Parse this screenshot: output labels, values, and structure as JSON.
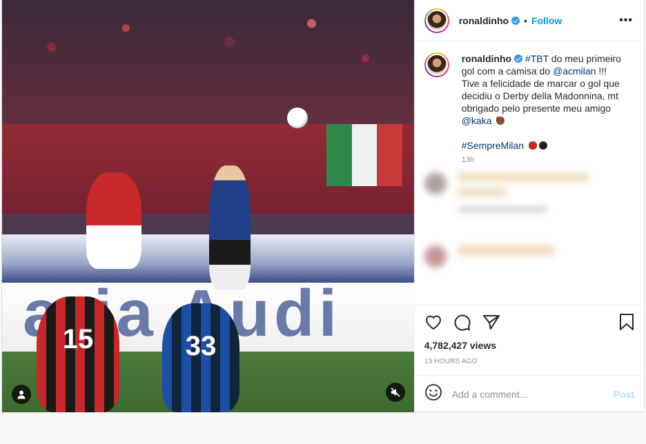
{
  "post": {
    "username": "ronaldinho",
    "follow_label": "Follow",
    "dot": "•",
    "more_label": "•••"
  },
  "caption": {
    "username": "ronaldinho",
    "line1": "#TBT",
    "line1_rest": " do meu primeiro gol com a camisa do ",
    "mention1": "@acmilan",
    "line1_end": " !!!",
    "line2": "Tive a felicidade de marcar o gol que decidiu o Derby della Madonnina, mt obrigado pelo presente meu amigo ",
    "mention2": "@kaka",
    "hashtag": "#SempreMilan",
    "time": "13h"
  },
  "video": {
    "board_text": "aria  Audi",
    "player1_number": "15",
    "player2_number": "33",
    "user_icon": "user-icon",
    "mute_icon": "muted-speaker-icon"
  },
  "actions": {
    "like_icon": "heart-icon",
    "comment_icon": "comment-icon",
    "share_icon": "paper-plane-icon",
    "save_icon": "bookmark-icon",
    "views": "4,782,427 views",
    "posted": "13 HOURS AGO"
  },
  "add_comment": {
    "emoji_icon": "smiley-icon",
    "placeholder": "Add a comment...",
    "post_label": "Post"
  },
  "colors": {
    "follow": "#0095f6",
    "post_disabled": "#b2dffc",
    "milan_red": "#d9261c",
    "milan_black": "#222222"
  }
}
